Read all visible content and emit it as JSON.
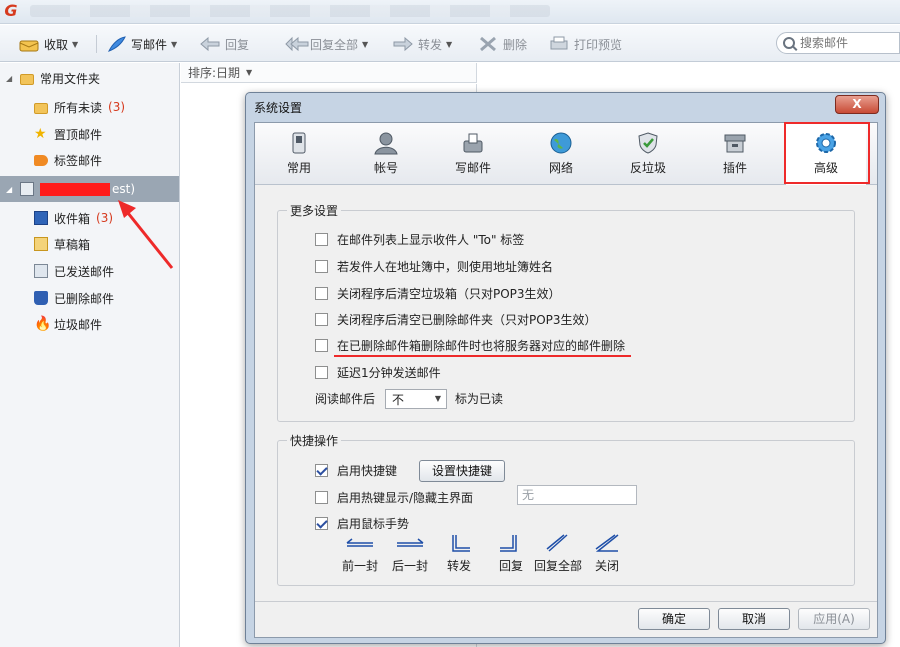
{
  "toolbar": {
    "receive": "收取",
    "compose": "写邮件",
    "reply": "回复",
    "reply_all": "回复全部",
    "forward": "转发",
    "delete": "删除",
    "print_preview": "打印预览"
  },
  "search": {
    "placeholder": "搜索邮件"
  },
  "folders": {
    "common": "常用文件夹",
    "unread": "所有未读",
    "unread_count": "(3)",
    "pinned": "置顶邮件",
    "tagged": "标签邮件",
    "account_suffix": "est)",
    "inbox": "收件箱",
    "inbox_count": "(3)",
    "drafts": "草稿箱",
    "sent": "已发送邮件",
    "deleted": "已删除邮件",
    "junk": "垃圾邮件"
  },
  "list": {
    "sort_label": "排序:日期"
  },
  "dialog": {
    "title": "系统设置",
    "close": "X",
    "tabs": [
      "常用",
      "帐号",
      "写邮件",
      "网络",
      "反垃圾",
      "插件",
      "高级"
    ],
    "group_more": "更多设置",
    "options": [
      {
        "label": "在邮件列表上显示收件人 \"To\" 标签",
        "checked": false
      },
      {
        "label": "若发件人在地址簿中，则使用地址簿姓名",
        "checked": false
      },
      {
        "label": "关闭程序后清空垃圾箱（只对POP3生效）",
        "checked": false
      },
      {
        "label": "关闭程序后清空已删除邮件夹（只对POP3生效）",
        "checked": false
      },
      {
        "label": "在已删除邮件箱删除邮件时也将服务器对应的邮件删除",
        "checked": false
      },
      {
        "label": "延迟1分钟发送邮件",
        "checked": false
      }
    ],
    "read_after_label": "阅读邮件后",
    "read_after_value": "不",
    "read_after_suffix": "标为已读",
    "group_shortcut": "快捷操作",
    "enable_shortcut": "启用快捷键",
    "enable_shortcut_checked": true,
    "set_shortcut_button": "设置快捷键",
    "enable_hotkey": "启用热键显示/隐藏主界面",
    "enable_hotkey_checked": false,
    "hotkey_value": "无",
    "enable_gesture": "启用鼠标手势",
    "enable_gesture_checked": true,
    "gestures": [
      "前一封",
      "后一封",
      "转发",
      "回复",
      "回复全部",
      "关闭"
    ],
    "ok": "确定",
    "cancel": "取消",
    "apply": "应用(A)"
  },
  "colors": {
    "annotation_red": "#ee2a2a",
    "unread_count": "#d63a1e",
    "selected_row": "#9aa6b3"
  }
}
